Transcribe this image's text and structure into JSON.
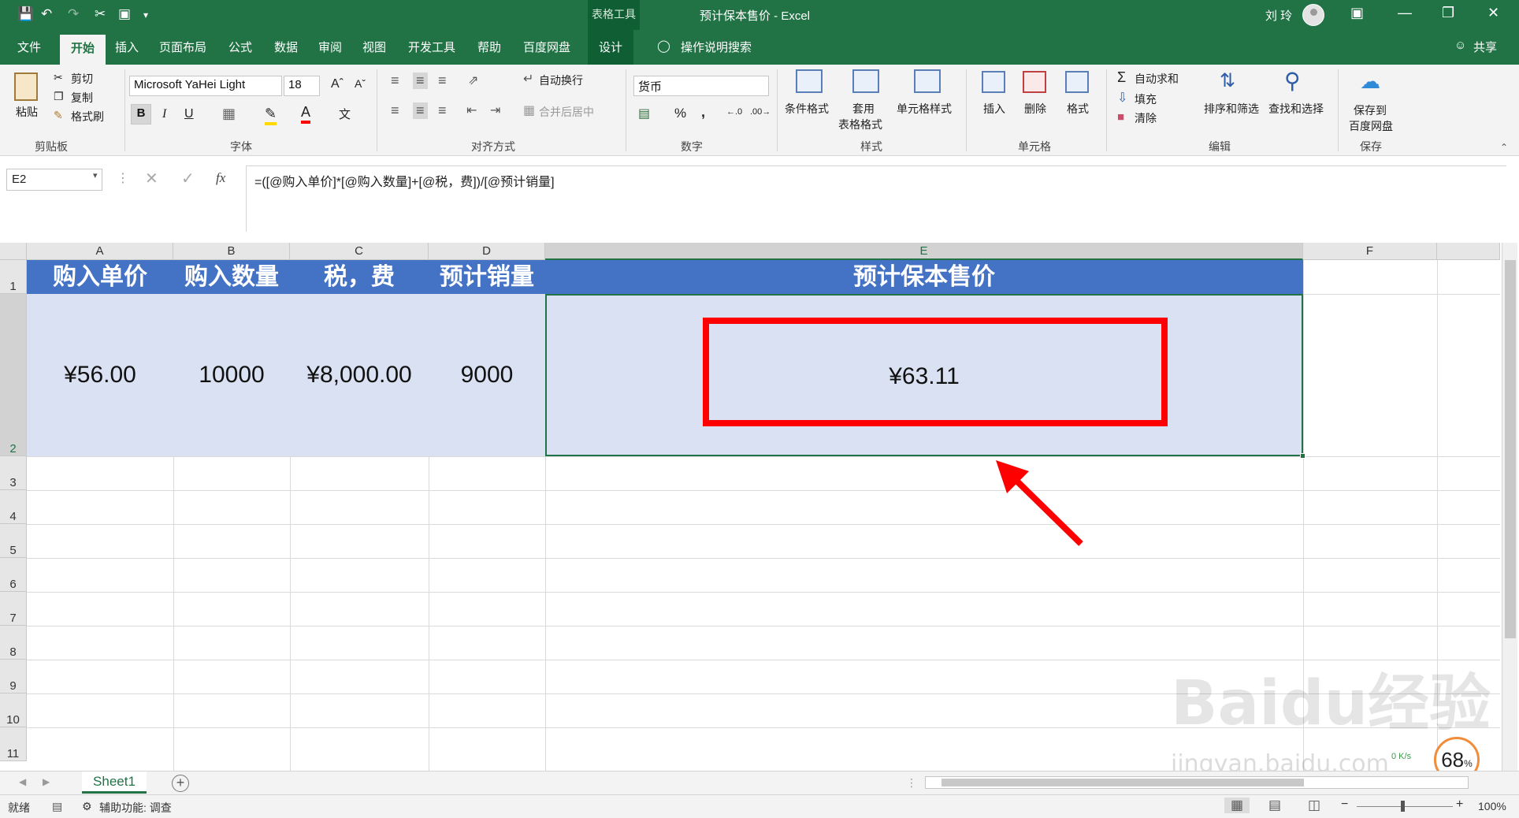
{
  "window": {
    "context_tab": "表格工具",
    "title": "预计保本售价 - Excel",
    "user": "刘 玲"
  },
  "tabs": [
    "文件",
    "开始",
    "插入",
    "页面布局",
    "公式",
    "数据",
    "审阅",
    "视图",
    "开发工具",
    "帮助",
    "百度网盘",
    "设计"
  ],
  "tell_me": "操作说明搜索",
  "share": "共享",
  "ribbon": {
    "clipboard": {
      "label": "剪贴板",
      "paste": "粘贴",
      "cut": "剪切",
      "copy": "复制",
      "format_painter": "格式刷"
    },
    "font": {
      "label": "字体",
      "name": "Microsoft YaHei Light",
      "size": "18",
      "bold": "B",
      "italic": "I",
      "underline": "U"
    },
    "alignment": {
      "label": "对齐方式",
      "wrap": "自动换行",
      "merge": "合并后居中"
    },
    "number": {
      "label": "数字",
      "format": "货币",
      "percent": "%",
      "comma": ","
    },
    "styles": {
      "label": "样式",
      "conditional": "条件格式",
      "table_l1": "套用",
      "table_l2": "表格格式",
      "cell_styles": "单元格样式"
    },
    "cells": {
      "label": "单元格",
      "insert": "插入",
      "delete": "删除",
      "format": "格式"
    },
    "editing": {
      "label": "编辑",
      "autosum": "自动求和",
      "fill": "填充",
      "clear": "清除",
      "sort": "排序和筛选",
      "find": "查找和选择"
    },
    "save": {
      "label": "保存",
      "line1": "保存到",
      "line2": "百度网盘"
    }
  },
  "formula_bar": {
    "name_box": "E2",
    "fx": "fx",
    "formula": "=([@购入单价]*[@购入数量]+[@税，费])/[@预计销量]"
  },
  "sheet": {
    "columns": [
      "A",
      "B",
      "C",
      "D",
      "E",
      "F"
    ],
    "rows": [
      "1",
      "2",
      "3",
      "4",
      "5",
      "6",
      "7",
      "8",
      "9",
      "10",
      "11"
    ],
    "headers": [
      "购入单价",
      "购入数量",
      "税，费",
      "预计销量",
      "预计保本售价"
    ],
    "values": [
      "¥56.00",
      "10000",
      "¥8,000.00",
      "9000",
      "¥63.11"
    ]
  },
  "sheet_tab": "Sheet1",
  "status": {
    "ready": "就绪",
    "accessibility": "辅助功能: 调查",
    "zoom": "100%"
  },
  "watermark": {
    "brand": "Baidu经验",
    "url": "jingyan.baidu.com",
    "speed": "68",
    "speed_unit": "%",
    "net": "0 K/s"
  },
  "colors": {
    "excel_green": "#217346",
    "header_blue": "#4472c4",
    "row_fill": "#d9e1f2",
    "highlight": "#ff0000"
  }
}
